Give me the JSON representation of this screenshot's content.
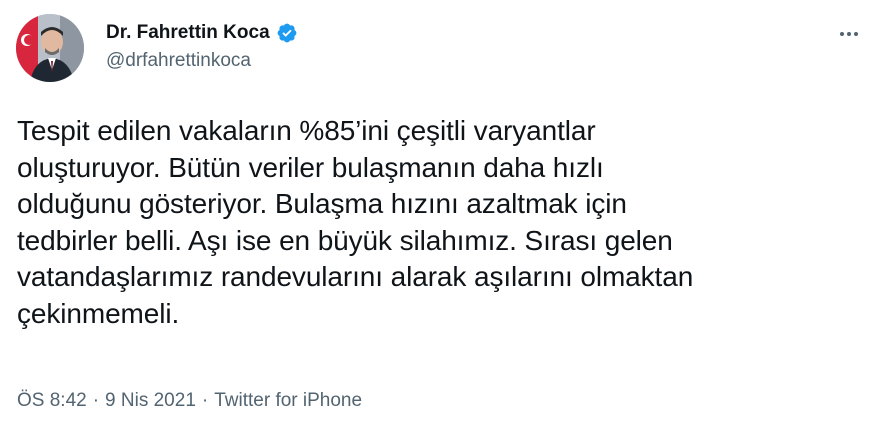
{
  "author": {
    "display_name": "Dr. Fahrettin Koca",
    "handle": "@drfahrettinkoca",
    "verified": true
  },
  "tweet": {
    "text": "Tespit edilen vakaların %85’ini çeşitli varyantlar\noluşturuyor. Bütün veriler bulaşmanın daha hızlı\nolduğunu gösteriyor. Bulaşma hızını azaltmak için\ntedbirler belli. Aşı ise en büyük silahımız. Sırası gelen\nvatandaşlarımız randevularını alarak aşılarını olmaktan\nçekinmemeli."
  },
  "meta": {
    "time": "ÖS 8:42",
    "separator_1": "·",
    "date": "9 Nis 2021",
    "separator_2": "·",
    "source": "Twitter for iPhone"
  },
  "icons": {
    "verified_badge": "verified-badge-icon",
    "more_menu": "more-options-icon"
  },
  "colors": {
    "primary_text": "#0f1419",
    "secondary_text": "#536471",
    "verified_blue": "#1d9bf0",
    "background": "#ffffff"
  }
}
